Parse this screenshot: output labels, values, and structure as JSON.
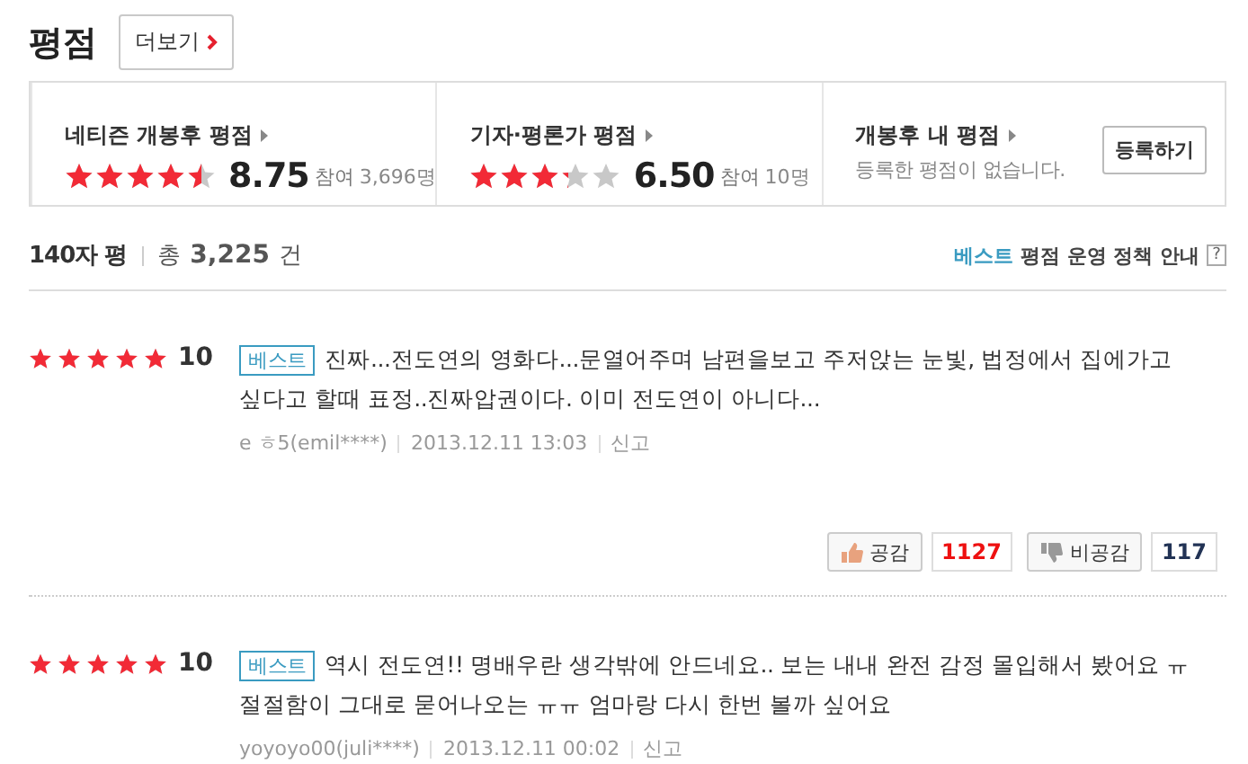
{
  "header": {
    "title": "평점",
    "more_button": "더보기"
  },
  "summary": [
    {
      "kind": "score",
      "title": "네티즌 개봉후 평점",
      "stars": 4.5,
      "score": "8.75",
      "participants_label": "참여",
      "participants": "3,696명"
    },
    {
      "kind": "score",
      "title": "기자·평론가 평점",
      "stars": 3.25,
      "score": "6.50",
      "participants_label": "참여",
      "participants": "10명"
    },
    {
      "kind": "mine",
      "title": "개봉후 내 평점",
      "message": "등록한 평점이 없습니다.",
      "button": "등록하기"
    }
  ],
  "list_header": {
    "title": "140자 평",
    "total_label": "총",
    "total": "3,225",
    "unit": "건",
    "policy_badge": "베스트",
    "policy_text": "평점 운영 정책 안내",
    "help": "?"
  },
  "reviews": [
    {
      "stars": 5,
      "score": "10",
      "best": true,
      "badge": "베스트",
      "text": "진짜...전도연의 영화다...문열어주며 남편을보고 주저앉는 눈빛, 법정에서 집에가고 싶다고 할때 표정..진짜압권이다. 이미 전도연이 아니다...",
      "author": "e ㅎ5(emil****)",
      "date": "2013.12.11 13:03",
      "report": "신고",
      "like_label": "공감",
      "likes": "1127",
      "dislike_label": "비공감",
      "dislikes": "117"
    },
    {
      "stars": 5,
      "score": "10",
      "best": true,
      "badge": "베스트",
      "text": "역시 전도연!! 명배우란 생각밖에 안드네요.. 보는 내내 완전 감정 몰입해서 봤어요 ㅠ 절절함이 그대로 묻어나오는 ㅠㅠ 엄마랑 다시 한번 볼까 싶어요",
      "author": "yoyoyo00(juli****)",
      "date": "2013.12.11 00:02",
      "report": "신고"
    }
  ]
}
